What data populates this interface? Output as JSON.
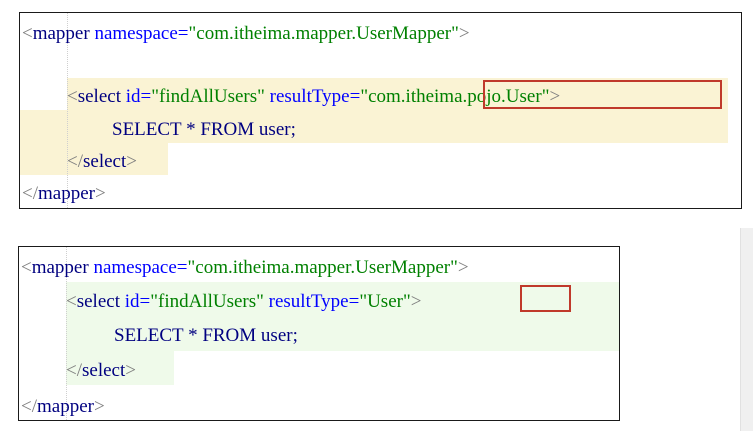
{
  "panel1": {
    "lines": [
      {
        "open": "<",
        "tag": "mapper",
        "attr": "namespace",
        "eq": "=",
        "value": "\"com.itheima.mapper.UserMapper\"",
        "close": ">"
      },
      {
        "blank": ""
      },
      {
        "open": "<",
        "tag": "select",
        "attr1": "id",
        "eq1": "=",
        "value1": "\"findAllUsers\"",
        "attr2": "resultType",
        "eq2": "=",
        "q_open": "\"",
        "value2": "com.itheima.pojo.User",
        "q_close": "\"",
        "close": ">"
      },
      {
        "sql": "SELECT * FROM user;"
      },
      {
        "open": "</",
        "tag": "select",
        "close": ">"
      },
      {
        "open": "</",
        "tag": "mapper",
        "close": ">"
      }
    ]
  },
  "panel2": {
    "lines": [
      {
        "open": "<",
        "tag": "mapper",
        "attr": "namespace",
        "eq": "=",
        "value": "\"com.itheima.mapper.UserMapper\"",
        "close": ">"
      },
      {
        "open": "<",
        "tag": "select",
        "attr1": "id",
        "eq1": "=",
        "value1": "\"findAllUsers\"",
        "attr2": "resultType",
        "eq2": "=",
        "q_open": "\"",
        "value2": "User",
        "q_close": "\"",
        "close": ">"
      },
      {
        "sql": "SELECT * FROM user;"
      },
      {
        "open": "</",
        "tag": "select",
        "close": ">"
      },
      {
        "open": "</",
        "tag": "mapper",
        "close": ">"
      }
    ]
  },
  "colors": {
    "tag": "#000080",
    "attr": "#0000ff",
    "string": "#008000",
    "highlight_box": "#c0392b",
    "band_panel1": "#faf3d4",
    "band_panel2": "#effaea"
  }
}
